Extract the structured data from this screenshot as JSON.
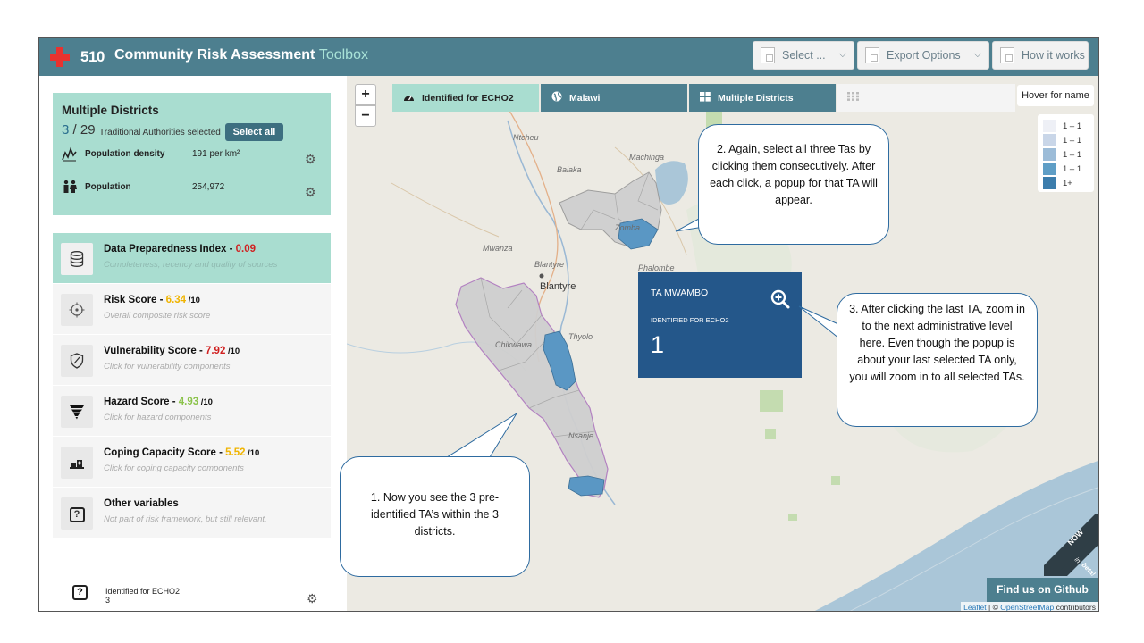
{
  "header": {
    "logo_number": "510",
    "title": "Community Risk Assessment",
    "title_accent": "Toolbox",
    "buttons": {
      "select": "Select ...",
      "export": "Export Options",
      "how": "How it works"
    }
  },
  "district_card": {
    "title": "Multiple Districts",
    "selected": "3",
    "sep": " / ",
    "total": "29",
    "ta_label": "Traditional Authorities selected",
    "select_all": "Select all",
    "stats": [
      {
        "label": "Population density",
        "value": "191 per km²"
      },
      {
        "label": "Population",
        "value": "254,972"
      }
    ]
  },
  "scores": [
    {
      "title": "Data Preparedness Index - ",
      "value": "0.09",
      "suffix": "",
      "sub": "Completeness, recency and quality of sources"
    },
    {
      "title": "Risk Score - ",
      "value": "6.34",
      "suffix": " /10",
      "sub": "Overall composite risk score"
    },
    {
      "title": "Vulnerability Score - ",
      "value": "7.92",
      "suffix": " /10",
      "sub": "Click for vulnerability components"
    },
    {
      "title": "Hazard Score - ",
      "value": "4.93",
      "suffix": " /10",
      "sub": "Click for hazard components"
    },
    {
      "title": "Coping Capacity Score - ",
      "value": "5.52",
      "suffix": " /10",
      "sub": "Click for coping capacity components"
    },
    {
      "title": "Other variables",
      "value": "",
      "suffix": "",
      "sub": "Not part of risk framework, but still relevant."
    }
  ],
  "echo_row": {
    "label": "Identified for ECHO2",
    "value": "3"
  },
  "map": {
    "zoom_in": "+",
    "zoom_out": "−",
    "tabs": [
      "Identified for ECHO2",
      "Malawi",
      "Multiple Districts"
    ],
    "hover": "Hover for name",
    "legend": [
      {
        "label": "1 – 1",
        "color": "#eef0f6"
      },
      {
        "label": "1 – 1",
        "color": "#c9d6e8"
      },
      {
        "label": "1 – 1",
        "color": "#9cbcd8"
      },
      {
        "label": "1 – 1",
        "color": "#5f9ec6"
      },
      {
        "label": "1+",
        "color": "#3c7dac"
      }
    ],
    "labels": {
      "ntcheu": "Ntcheu",
      "balaka": "Balaka",
      "machinga": "Machinga",
      "zomba": "Zomba",
      "mwanza": "Mwanza",
      "blantyre_small": "Blantyre",
      "phalombe": "Phalombe",
      "blantyre": "Blantyre",
      "thyolo": "Thyolo",
      "chikwawa": "Chikwawa",
      "nsanje": "Nsanje"
    },
    "popup": {
      "ta": "TA MWAMBO",
      "label": "IDENTIFIED FOR ECHO2",
      "value": "1"
    },
    "github": "Find us on Github",
    "attrib_leaflet": "Leaflet",
    "attrib_mid": " | © ",
    "attrib_osm": "OpenStreetMap",
    "attrib_end": " contributors",
    "beta_now": "NOW",
    "beta_in": "in",
    "beta_word": "beta!"
  },
  "callouts": {
    "c1": "1. Now you see the 3 pre-identified TA’s within the 3 districts.",
    "c2": "2. Again, select all three Tas by clicking them consecutively. After each click, a popup  for that TA will appear.",
    "c3": "3. After clicking the last TA, zoom in to the next administrative level here. Even though the popup is about your last selected TA only, you will zoom in to all selected TAs."
  }
}
